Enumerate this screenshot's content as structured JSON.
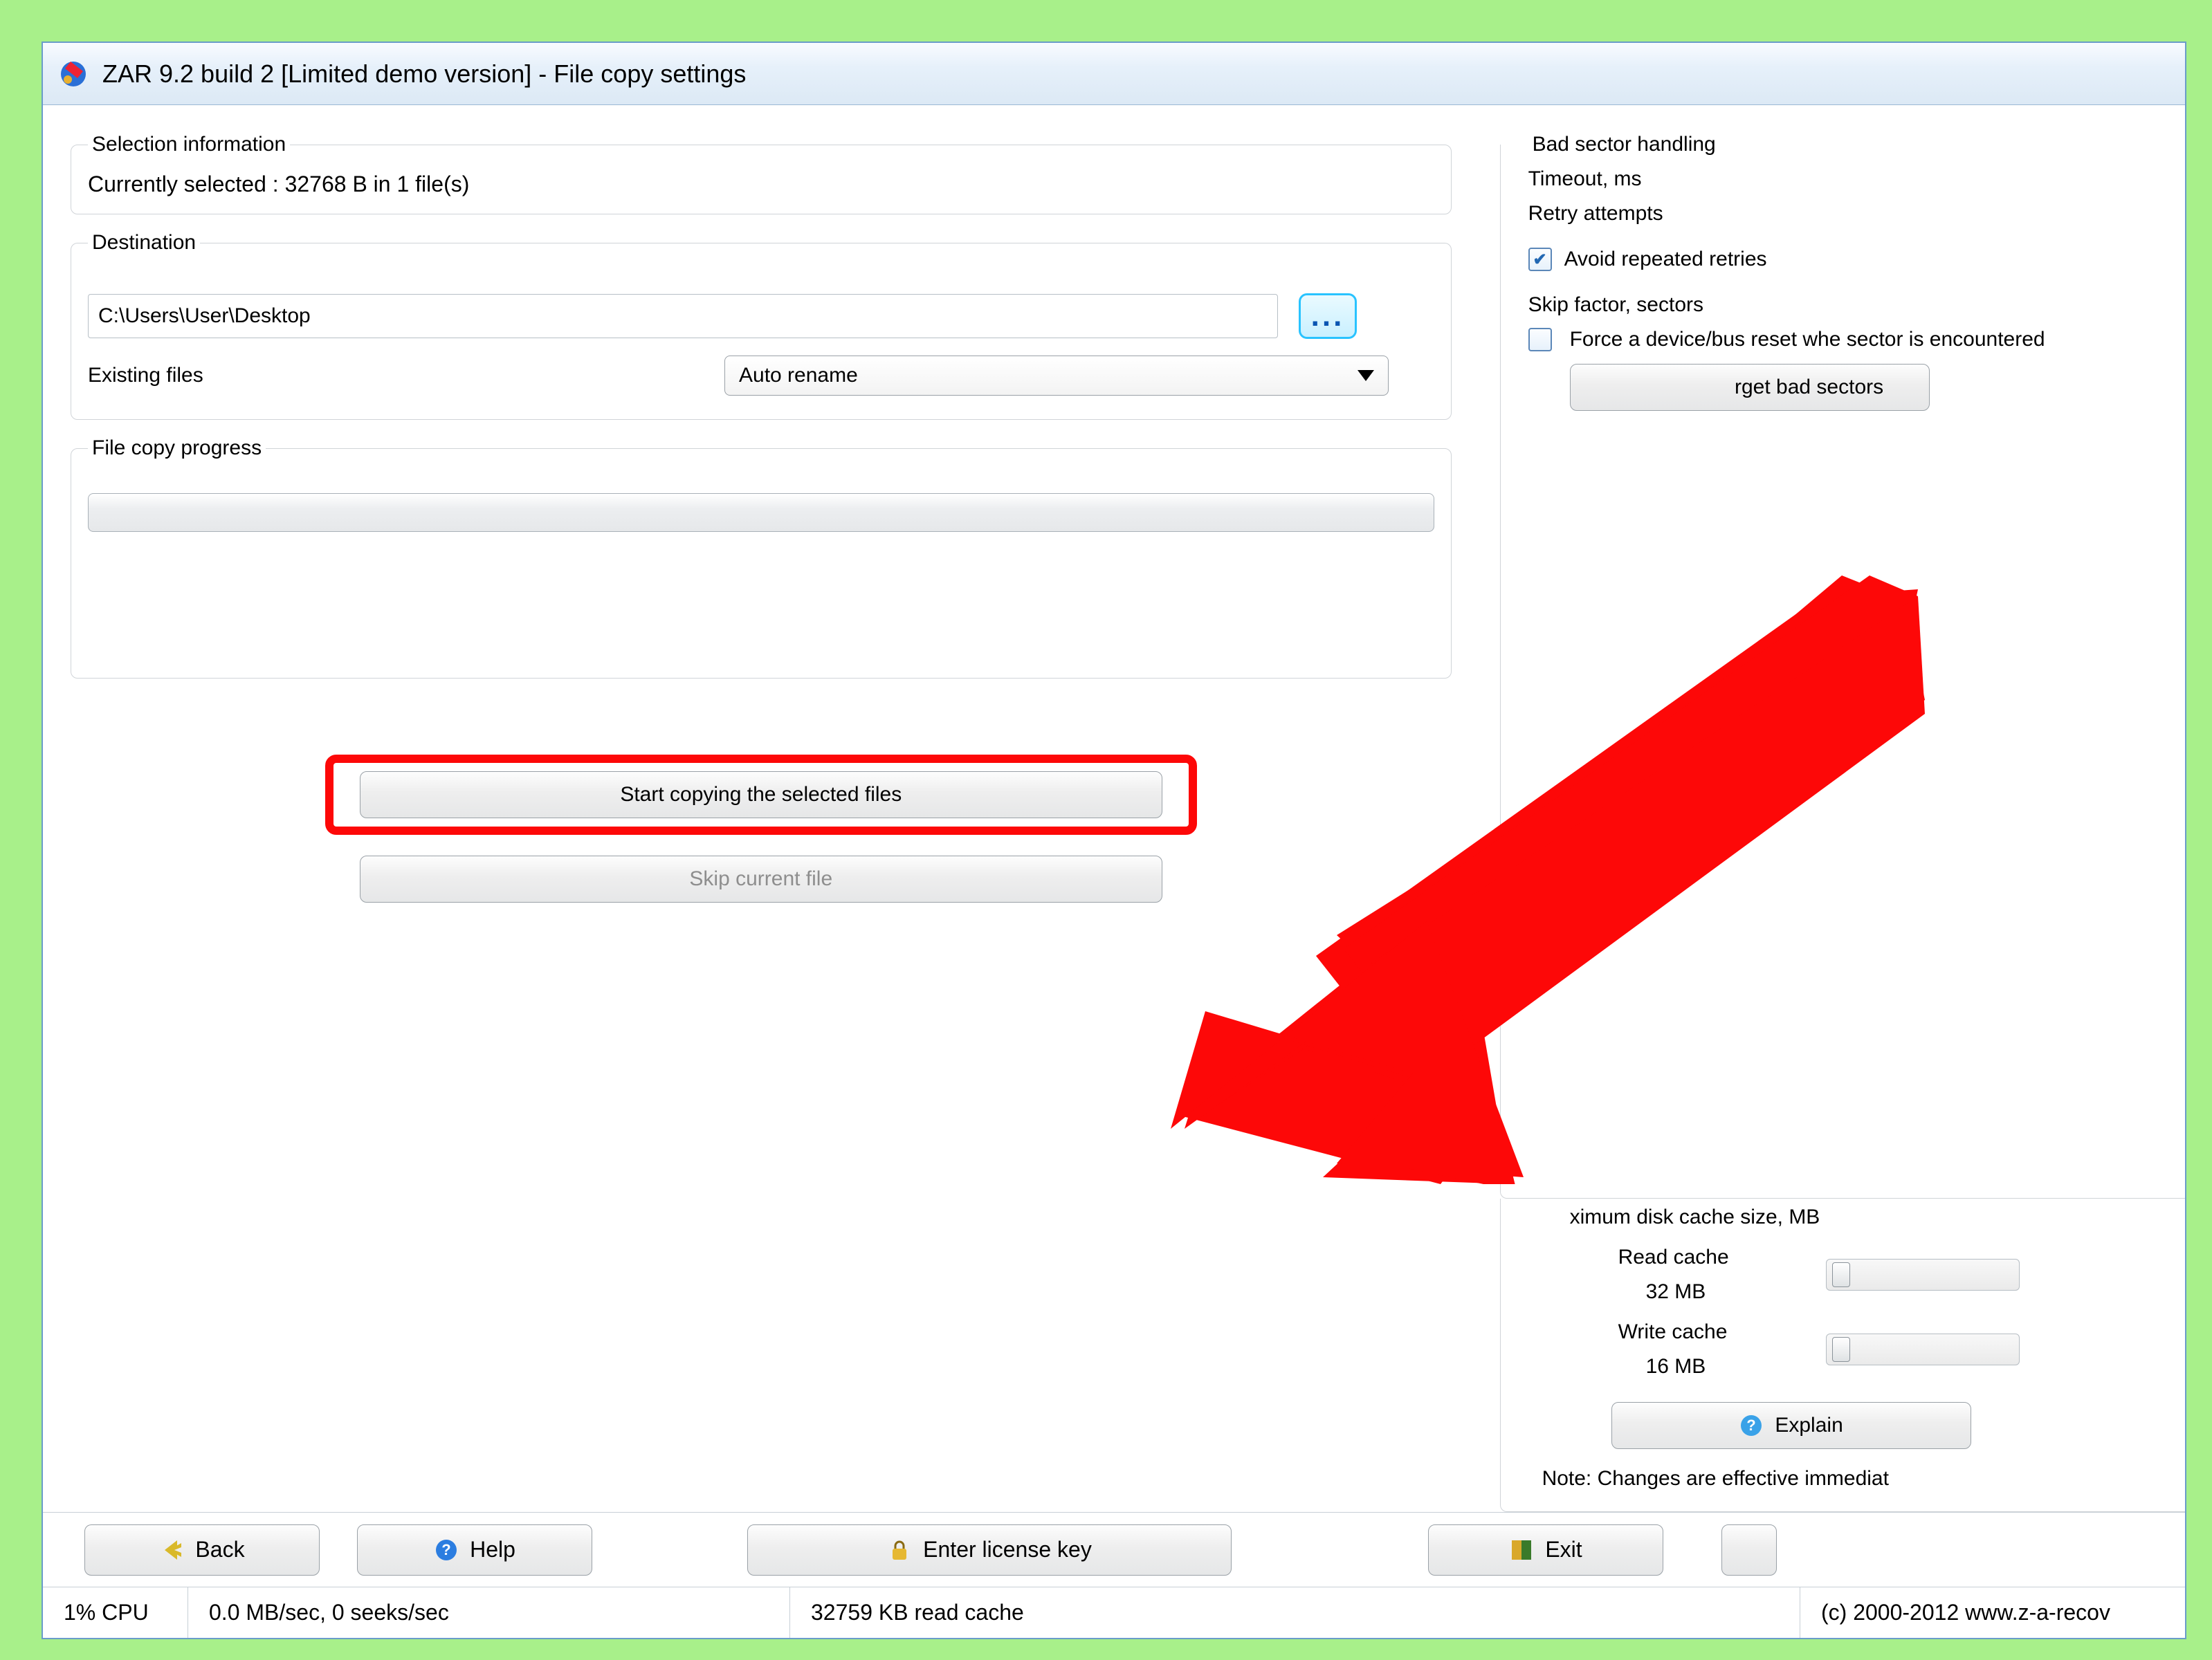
{
  "window": {
    "title": "ZAR 9.2 build 2 [Limited demo version] - File copy settings"
  },
  "selection": {
    "legend": "Selection information",
    "text": "Currently selected : 32768 B in 1 file(s)"
  },
  "destination": {
    "legend": "Destination",
    "path": "C:\\Users\\User\\Desktop",
    "browse": "...",
    "existing_label": "Existing files",
    "existing_value": "Auto rename"
  },
  "progress": {
    "legend": "File copy progress"
  },
  "actions": {
    "start": "Start copying the selected files",
    "skip": "Skip current file"
  },
  "right": {
    "legend": "Bad sector handling",
    "timeout_label": "Timeout, ms",
    "retry_label": "Retry attempts",
    "avoid_label": "Avoid repeated retries",
    "skip_factor_label": "Skip factor, sectors",
    "force_reset_label": "Force a device/bus reset whe sector is encountered",
    "forget_btn": "rget bad sectors",
    "cache_title": "ximum disk cache size, MB",
    "read_cache_label": "Read cache",
    "read_cache_value": "32 MB",
    "write_cache_label": "Write cache",
    "write_cache_value": "16 MB",
    "explain_btn": "Explain",
    "note": "Note: Changes are effective immediat"
  },
  "bottom": {
    "back": "Back",
    "help": "Help",
    "license": "Enter license key",
    "exit": "Exit"
  },
  "status": {
    "cpu": "1% CPU",
    "io": "0.0 MB/sec, 0 seeks/sec",
    "cache": "32759 KB read cache",
    "copyright": "(c) 2000-2012 www.z-a-recov"
  }
}
